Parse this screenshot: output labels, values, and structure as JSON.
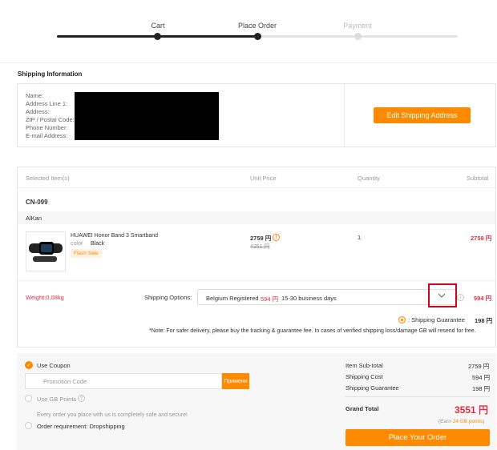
{
  "progress": {
    "steps": [
      {
        "label": "Cart"
      },
      {
        "label": "Place Order"
      },
      {
        "label": "Payment"
      }
    ]
  },
  "shipping_info": {
    "title": "Shipping Information",
    "fields": [
      "Name:",
      "Address Line 1:",
      "Address:",
      "ZIP / Postal Code:",
      "Phone Number:",
      "E-mail Address:"
    ],
    "edit_button": "Edit Shipping Address"
  },
  "items_table": {
    "headers": {
      "selected": "Selected Item(s)",
      "unit_price": "Unit Price",
      "quantity": "Quantity",
      "subtotal": "Subtotal"
    },
    "warehouse": "CN-099",
    "seller": "AlKan",
    "item": {
      "name": "HUAWEI Honor Band 3 Smartband",
      "color_label": "color",
      "color_value": "Black",
      "badge": "Flash Sale",
      "price": "2759 円",
      "old_price": "4351 円",
      "quantity": "1",
      "subtotal": "2759 円"
    }
  },
  "shipping": {
    "weight": "Weight:0.08kg",
    "options_label": "Shipping Options:",
    "method": "Belgium Registered",
    "method_price": "594 円",
    "method_time": "15-30 business days",
    "price": "594 円",
    "guarantee_label": ": Shipping Guarantee",
    "guarantee_price": "198 円",
    "note": "*Note: For safer delivery, please buy the tracking & guarantee fee. In cases of verified shipping loss/damage GB will resend for free."
  },
  "payment_options": {
    "coupon_label": "Use Coupon",
    "promo_placeholder": "Promotion Code",
    "apply_label": "Примени",
    "gb_points_label": "Use GB Points",
    "safe_text": "Every order you place with us is completely safe and secure!",
    "dropshipping_label": "Order requirement: Dropshipping"
  },
  "summary": {
    "rows": [
      {
        "label": "Item Sub-total",
        "value": "2759 円"
      },
      {
        "label": "Shipping Cost",
        "value": "594 円"
      },
      {
        "label": "Shipping Guarantee",
        "value": "198 円"
      }
    ],
    "grand_total_label": "Grand Total",
    "grand_total_value": "3551 円",
    "earn_prefix": "(Earn ",
    "earn_points": "24 GB points",
    "earn_suffix": ")",
    "place_order_button": "Place Your Order"
  },
  "colors": {
    "accent": "#ff8a00",
    "price_red": "#e02e45",
    "highlight_red": "#d0021b"
  },
  "icons": {
    "watch_image": "smartband-image",
    "dropdown": "chevron-down-icon",
    "info": "info-icon",
    "checkmark": "check-icon"
  }
}
